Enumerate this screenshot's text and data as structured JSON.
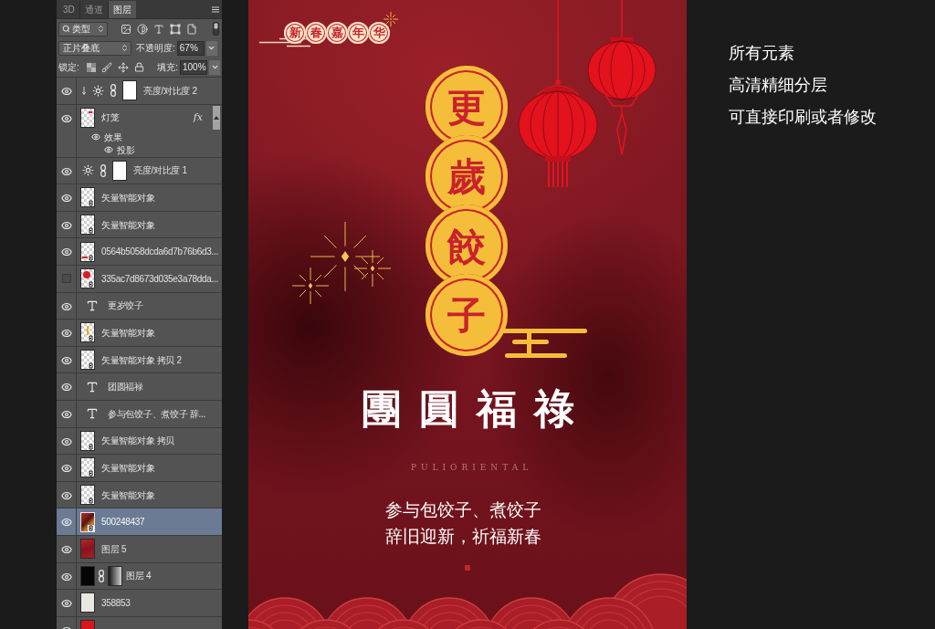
{
  "layers_panel": {
    "tabs": [
      {
        "label": "3D",
        "selected": false
      },
      {
        "label": "通道",
        "selected": false
      },
      {
        "label": "图层",
        "selected": true
      }
    ],
    "filter": {
      "value": "类型"
    },
    "blend_mode": {
      "value": "正片叠底"
    },
    "opacity": {
      "label": "不透明度:",
      "value": "67%"
    },
    "lock": {
      "label": "锁定:"
    },
    "fill": {
      "label": "填充:",
      "value": "100%"
    },
    "layers": [
      {
        "kind": "adjustment",
        "name": "亮度/对比度 2",
        "visible": true,
        "selected": false,
        "clipped": true
      },
      {
        "kind": "pixel",
        "thumbnail": {
          "kind": "red-corner"
        },
        "name": "灯笼",
        "visible": true,
        "selected": false,
        "clipped": false,
        "fx": "fx",
        "expanded": true,
        "effects": [
          {
            "name": "效果",
            "visible": true,
            "children": [
              {
                "name": "投影",
                "visible": true
              }
            ]
          }
        ]
      },
      {
        "kind": "adjustment",
        "name": "亮度/对比度 1",
        "visible": true,
        "selected": false,
        "clipped": false
      },
      {
        "kind": "smart",
        "thumbnail": {
          "kind": "clear"
        },
        "name": "矢量智能对象",
        "visible": true,
        "selected": false,
        "clipped": false
      },
      {
        "kind": "smart",
        "thumbnail": {
          "kind": "clear"
        },
        "name": "矢量智能对象",
        "visible": true,
        "selected": false,
        "clipped": false
      },
      {
        "kind": "smart",
        "thumbnail": {
          "kind": "red-bottom"
        },
        "name": "0564b5058dcda6d7b76b6d3...",
        "visible": true,
        "selected": false,
        "clipped": false
      },
      {
        "kind": "smart",
        "thumbnail": {
          "kind": "red-ball"
        },
        "name": "335ac7d8673d035e3a78dda...",
        "visible": false,
        "selected": false,
        "clipped": false
      },
      {
        "kind": "text",
        "name": "更岁饺子",
        "visible": true,
        "selected": false,
        "clipped": false
      },
      {
        "kind": "smart",
        "thumbnail": {
          "kind": "gold-bar"
        },
        "name": "矢量智能对象",
        "visible": true,
        "selected": false,
        "clipped": false
      },
      {
        "kind": "smart",
        "thumbnail": {
          "kind": "clear"
        },
        "name": "矢量智能对象 拷贝 2",
        "visible": true,
        "selected": false,
        "clipped": false
      },
      {
        "kind": "text",
        "name": "团圆福禄",
        "visible": true,
        "selected": false,
        "clipped": false
      },
      {
        "kind": "text",
        "name": "参与包饺子、煮饺子 辞...",
        "visible": true,
        "selected": false,
        "clipped": false
      },
      {
        "kind": "smart",
        "thumbnail": {
          "kind": "clear"
        },
        "name": "矢量智能对象 拷贝",
        "visible": true,
        "selected": false,
        "clipped": false
      },
      {
        "kind": "smart",
        "thumbnail": {
          "kind": "clear"
        },
        "name": "矢量智能对象",
        "visible": true,
        "selected": false,
        "clipped": false
      },
      {
        "kind": "smart",
        "thumbnail": {
          "kind": "clear"
        },
        "name": "矢量智能对象",
        "visible": true,
        "selected": false,
        "clipped": false
      },
      {
        "kind": "smart",
        "thumbnail": {
          "kind": "photo"
        },
        "name": "500248437",
        "visible": true,
        "selected": true,
        "clipped": false
      },
      {
        "kind": "pixel",
        "thumbnail": {
          "kind": "red-fabric"
        },
        "name": "图层 5",
        "visible": true,
        "selected": false,
        "clipped": false
      },
      {
        "kind": "masked",
        "thumbnail": {
          "kind": "black"
        },
        "name": "图层 4",
        "visible": true,
        "selected": false,
        "clipped": false
      },
      {
        "kind": "pixel",
        "thumbnail": {
          "kind": "cream"
        },
        "name": "358853",
        "visible": true,
        "selected": false,
        "clipped": false
      },
      {
        "kind": "pixel",
        "thumbnail": {
          "kind": "red"
        },
        "visible": true,
        "selected": false,
        "clipped": false
      }
    ]
  },
  "poster": {
    "badge": [
      "新",
      "春",
      "嘉",
      "年",
      "华"
    ],
    "title": [
      "更",
      "歲",
      "餃",
      "子"
    ],
    "headline": "團圓福祿",
    "brand": "PULIORIENTAL",
    "lines": [
      "参与包饺子、煮饺子",
      "辞旧迎新，祈福新春"
    ]
  },
  "notes": [
    "所有元素",
    "高清精细分层",
    "可直接印刷或者修改"
  ]
}
